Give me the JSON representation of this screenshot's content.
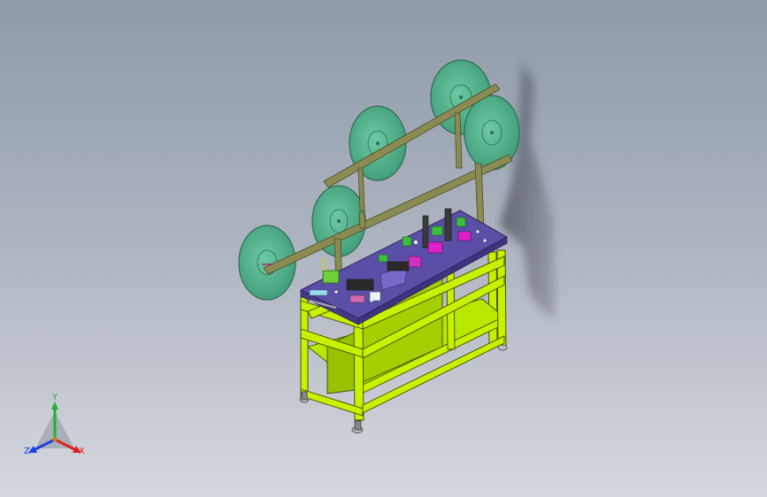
{
  "viewport": {
    "background_top": "#8f9aa9",
    "background_bottom": "#d5d8de",
    "frame_color": "#c8f000",
    "frame_edge_color": "#3c4a00",
    "table_top_color": "#5a4fa6",
    "reel_color": "#4fb08a",
    "reel_rim_color": "#2f6a52",
    "rack_color": "#8a8a52",
    "shadow_color": "#4a4e57"
  },
  "triad": {
    "x_label": "X",
    "y_label": "Y",
    "z_label": "Z",
    "x_color": "#e02020",
    "y_color": "#20b030",
    "z_color": "#2040e0"
  }
}
